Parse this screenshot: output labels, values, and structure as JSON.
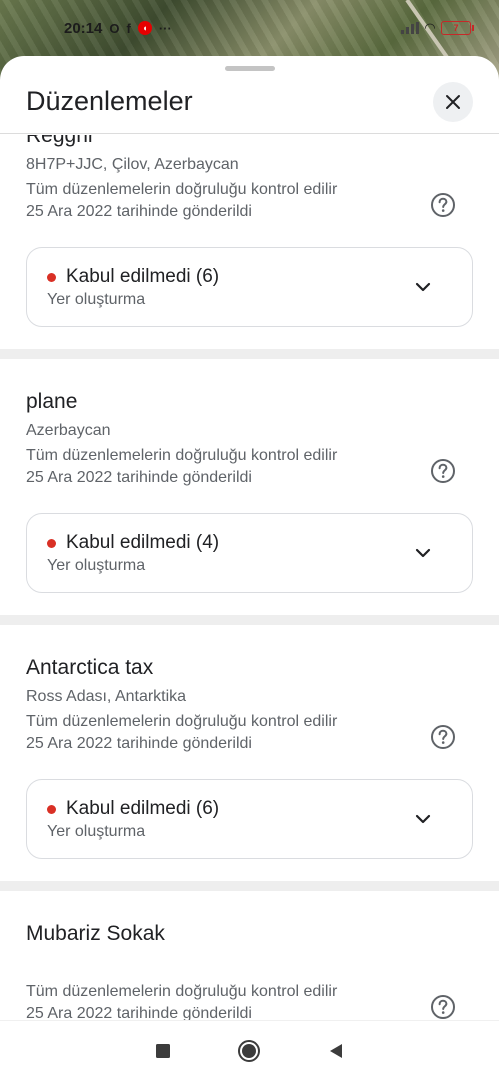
{
  "status_bar": {
    "time": "20:14",
    "battery": "7"
  },
  "sheet": {
    "title": "Düzenlemeler"
  },
  "entries": [
    {
      "name": "Regghr",
      "address": "8H7P+JJC, Çilov, Azerbaycan",
      "info_line1": "Tüm düzenlemelerin doğruluğu kontrol edilir",
      "info_line2": "25 Ara 2022 tarihinde gönderildi",
      "status": "Kabul edilmedi (6)",
      "type": "Yer oluşturma"
    },
    {
      "name": "plane",
      "address": "Azerbaycan",
      "info_line1": "Tüm düzenlemelerin doğruluğu kontrol edilir",
      "info_line2": "25 Ara 2022 tarihinde gönderildi",
      "status": "Kabul edilmedi (4)",
      "type": "Yer oluşturma"
    },
    {
      "name": "Antarctica tax",
      "address": "Ross Adası, Antarktika",
      "info_line1": "Tüm düzenlemelerin doğruluğu kontrol edilir",
      "info_line2": "25 Ara 2022 tarihinde gönderildi",
      "status": "Kabul edilmedi (6)",
      "type": "Yer oluşturma"
    },
    {
      "name": "Mubariz Sokak",
      "address": "",
      "info_line1": "Tüm düzenlemelerin doğruluğu kontrol edilir",
      "info_line2": "25 Ara 2022 tarihinde gönderildi"
    }
  ],
  "colors": {
    "status_dot": "#d93025",
    "text_primary": "#202124",
    "text_secondary": "#5f6368"
  },
  "icons": {
    "close": "close-icon",
    "help": "help-circle-icon",
    "expand": "chevron-down-icon",
    "nav_recents": "square-icon",
    "nav_home": "circle-icon",
    "nav_back": "triangle-back-icon"
  }
}
